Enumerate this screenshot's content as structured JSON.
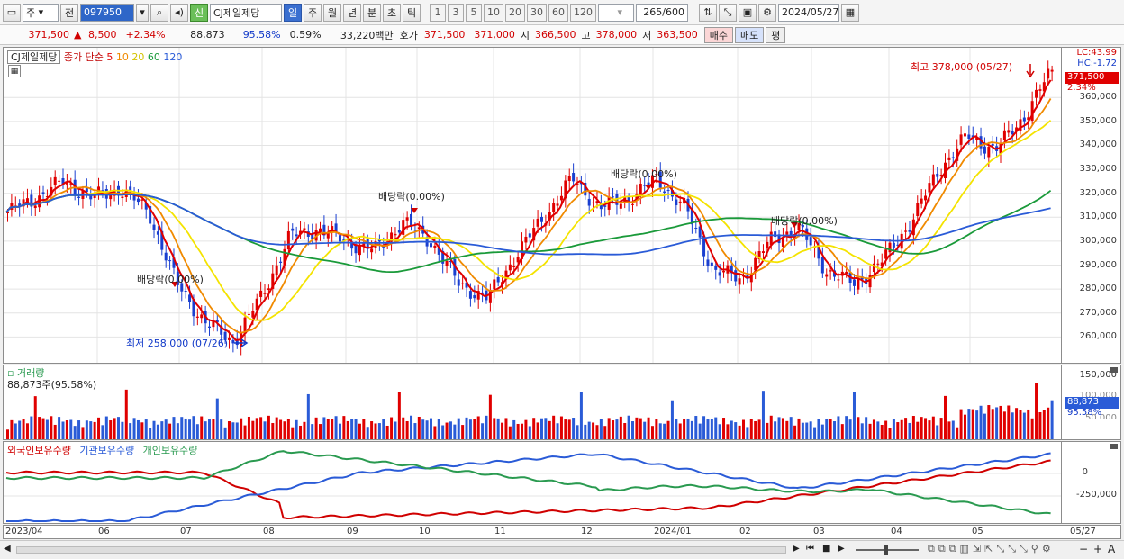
{
  "toolbar": {
    "market": "주",
    "prev": "전",
    "code": "097950",
    "sin": "신",
    "name": "CJ제일제당",
    "periods": [
      "일",
      "주",
      "월",
      "년",
      "분",
      "초",
      "틱"
    ],
    "selected_period": "일",
    "intervals": [
      "1",
      "3",
      "5",
      "10",
      "20",
      "30",
      "60",
      "120"
    ],
    "count": "265",
    "count_max": "/600",
    "date": "2024/05/27"
  },
  "status": {
    "price": "371,500",
    "change": "8,500",
    "rate": "+2.34%",
    "volume": "88,873",
    "vol_ratio": "95.58%",
    "turnover": "0.59%",
    "amount": "33,220백만",
    "quote_label": "호가",
    "ask": "371,500",
    "bid": "371,000",
    "open_label": "시",
    "open": "366,500",
    "high_label": "고",
    "high": "378,000",
    "low_label": "저",
    "low": "363,500",
    "buy": "매수",
    "sell": "매도",
    "eval": "평"
  },
  "price_panel": {
    "title": "CJ제일제당",
    "ma_label": "종가 단순",
    "ma_periods": [
      "5",
      "10",
      "20",
      "60",
      "120"
    ],
    "ma_colors": [
      "#e00000",
      "#f08a00",
      "#f4e300",
      "#1a9a3a",
      "#2a5bd7"
    ],
    "lc": "LC:43.99",
    "hc": "HC:-1.72",
    "last_price": "371,500",
    "last_rate": "2.34%",
    "y_ticks": [
      "360,000",
      "350,000",
      "340,000",
      "330,000",
      "320,000",
      "310,000",
      "300,000",
      "290,000",
      "280,000",
      "270,000",
      "260,000"
    ],
    "ann_high": "최고 378,000 (05/27)",
    "ann_low": "최저 258,000 (07/26)",
    "ann_div": "배당락(0.00%)"
  },
  "volume_panel": {
    "title": "거래량",
    "value": "88,873주(95.58%)",
    "y_ticks": [
      "150,000",
      "100,000"
    ],
    "y_tick_hidden": "50,000",
    "last_value": "88,873",
    "last_rate": "95.58%"
  },
  "holdings_panel": {
    "series": [
      "외국인보유수량",
      "기관보유수량",
      "개인보유수량"
    ],
    "colors": [
      "#d00000",
      "#2a5bd7",
      "#2a9a50"
    ],
    "y_ticks": [
      "0",
      "-250,000"
    ]
  },
  "x_axis": {
    "labels": [
      "2023/04",
      "06",
      "07",
      "08",
      "09",
      "10",
      "11",
      "12",
      "2024/01",
      "02",
      "03",
      "04",
      "05",
      "05/27"
    ]
  },
  "chart_data": {
    "type": "candlestick",
    "title": "CJ제일제당",
    "ylim": [
      250000,
      380000
    ],
    "x_range": [
      "2023/04",
      "2024/05/27"
    ],
    "ma_periods": [
      5,
      10,
      20,
      60,
      120
    ],
    "close_path": [
      [
        "2023/04",
        312000
      ],
      [
        "05",
        318000
      ],
      [
        "05",
        325000
      ],
      [
        "06",
        318000
      ],
      [
        "06",
        322000
      ],
      [
        "06",
        312000
      ],
      [
        "07",
        282000
      ],
      [
        "07",
        266000
      ],
      [
        "07",
        258000
      ],
      [
        "08",
        277000
      ],
      [
        "08",
        302000
      ],
      [
        "09",
        305000
      ],
      [
        "09",
        300000
      ],
      [
        "09",
        296000
      ],
      [
        "10",
        308000
      ],
      [
        "10",
        300000
      ],
      [
        "10",
        282000
      ],
      [
        "11",
        276000
      ],
      [
        "11",
        294000
      ],
      [
        "11",
        310000
      ],
      [
        "12",
        326000
      ],
      [
        "12",
        314000
      ],
      [
        "12",
        318000
      ],
      [
        "2024/01",
        326000
      ],
      [
        "2024/01",
        314000
      ],
      [
        "02",
        288000
      ],
      [
        "02",
        284000
      ],
      [
        "02",
        300000
      ],
      [
        "03",
        306000
      ],
      [
        "03",
        288000
      ],
      [
        "03",
        282000
      ],
      [
        "04",
        292000
      ],
      [
        "04",
        308000
      ],
      [
        "04",
        330000
      ],
      [
        "05",
        344000
      ],
      [
        "05",
        338000
      ],
      [
        "05",
        352000
      ],
      [
        "05/27",
        371500
      ]
    ],
    "high": 378000,
    "high_date": "05/27",
    "low": 258000,
    "low_date": "07/26",
    "volume_last": 88873,
    "volume_ylim": [
      0,
      160000
    ]
  }
}
